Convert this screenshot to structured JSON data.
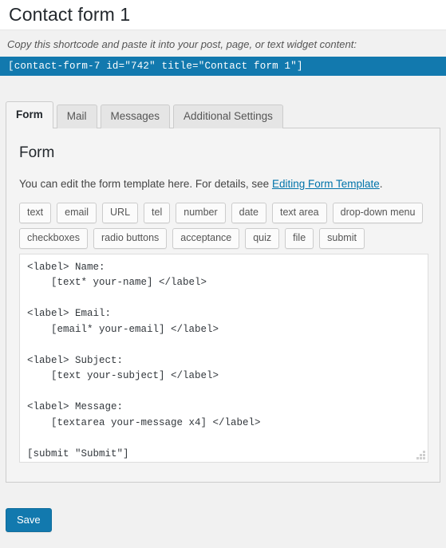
{
  "header": {
    "title": "Contact form 1"
  },
  "shortcode": {
    "description": "Copy this shortcode and paste it into your post, page, or text widget content:",
    "value": "[contact-form-7 id=\"742\" title=\"Contact form 1\"]"
  },
  "tabs": [
    {
      "label": "Form",
      "active": true
    },
    {
      "label": "Mail",
      "active": false
    },
    {
      "label": "Messages",
      "active": false
    },
    {
      "label": "Additional Settings",
      "active": false
    }
  ],
  "panel": {
    "title": "Form",
    "description_before": "You can edit the form template here. For details, see ",
    "description_link": "Editing Form Template",
    "description_after": ".",
    "tag_rows": [
      [
        "text",
        "email",
        "URL",
        "tel",
        "number",
        "date",
        "text area",
        "drop-down menu"
      ],
      [
        "checkboxes",
        "radio buttons",
        "acceptance",
        "quiz",
        "file",
        "submit"
      ]
    ],
    "form_template": "<label> Name:\n    [text* your-name] </label>\n\n<label> Email:\n    [email* your-email] </label>\n\n<label> Subject:\n    [text your-subject] </label>\n\n<label> Message:\n    [textarea your-message x4] </label>\n\n[submit \"Submit\"]"
  },
  "footer": {
    "save_label": "Save"
  },
  "colors": {
    "accent_blue": "#1279ae",
    "link_blue": "#0073aa",
    "page_bg": "#f1f1f1",
    "panel_bg": "#f4f4f4",
    "text_dark": "#23282d"
  }
}
